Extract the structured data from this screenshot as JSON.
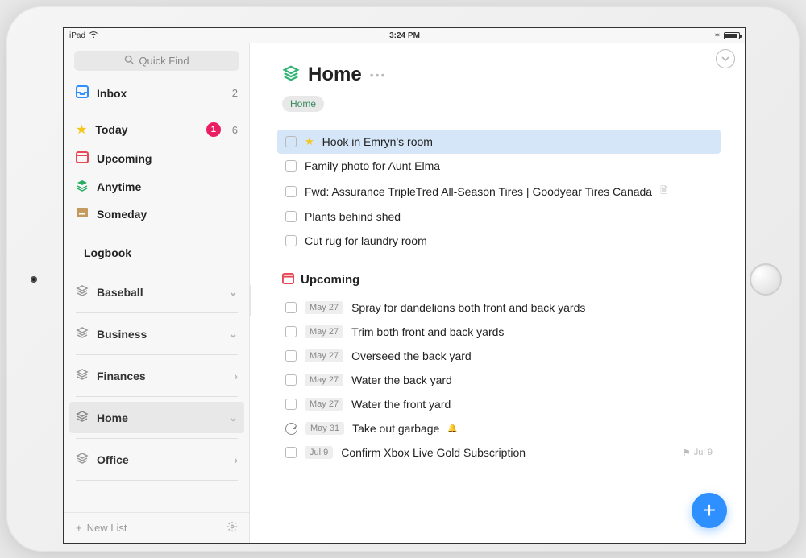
{
  "status": {
    "carrier": "iPad",
    "time": "3:24 PM"
  },
  "search": {
    "placeholder": "Quick Find"
  },
  "sidebar": {
    "inbox": {
      "label": "Inbox",
      "count": "2"
    },
    "today": {
      "label": "Today",
      "badge": "1",
      "count": "6"
    },
    "upcoming": {
      "label": "Upcoming"
    },
    "anytime": {
      "label": "Anytime"
    },
    "someday": {
      "label": "Someday"
    },
    "logbook": {
      "label": "Logbook"
    },
    "areas": [
      {
        "label": "Baseball",
        "chev": "⌄"
      },
      {
        "label": "Business",
        "chev": "⌄"
      },
      {
        "label": "Finances",
        "chev": "›"
      },
      {
        "label": "Home",
        "chev": "⌄"
      },
      {
        "label": "Office",
        "chev": "›"
      }
    ],
    "newList": "New List"
  },
  "main": {
    "areaTitle": "Home",
    "tag": "Home",
    "tasks": [
      {
        "title": "Hook in Emryn's room",
        "starred": true,
        "selected": true
      },
      {
        "title": "Family photo for Aunt Elma"
      },
      {
        "title": "Fwd: Assurance TripleTred All-Season Tires | Goodyear Tires Canada",
        "attach": true
      },
      {
        "title": "Plants behind shed"
      },
      {
        "title": "Cut rug for laundry room"
      }
    ],
    "upcomingHeader": "Upcoming",
    "upcoming": [
      {
        "date": "May 27",
        "title": "Spray for dandelions both front and back yards"
      },
      {
        "date": "May 27",
        "title": "Trim both front and back yards"
      },
      {
        "date": "May 27",
        "title": "Overseed the back yard"
      },
      {
        "date": "May 27",
        "title": "Water the back yard"
      },
      {
        "date": "May 27",
        "title": "Water the front yard"
      },
      {
        "date": "May 31",
        "title": "Take out garbage",
        "recur": true,
        "bell": true
      },
      {
        "date": "Jul 9",
        "title": "Confirm Xbox Live Gold Subscription",
        "deadline": "Jul 9"
      }
    ]
  }
}
